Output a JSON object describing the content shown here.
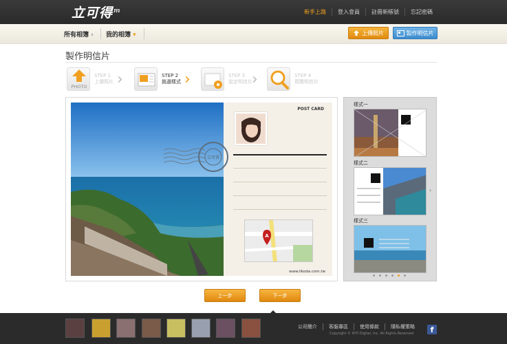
{
  "header": {
    "logo": "立可得",
    "logo_mark": "m",
    "links": [
      "新手上路",
      "登入會員",
      "註冊新帳號",
      "忘記密碼"
    ]
  },
  "subnav": {
    "tab_all": "所有相簿",
    "tab_mine": "我的相簿",
    "upload_label": "上傳照片",
    "make_label": "製作明信片"
  },
  "page_title": "製作明信片",
  "steps": [
    {
      "step": "STEP 1",
      "name": "上傳照片",
      "icon_text": "PHOTO"
    },
    {
      "step": "STEP 2",
      "name": "挑選樣式"
    },
    {
      "step": "STEP 3",
      "name": "設定明信片"
    },
    {
      "step": "STEP 4",
      "name": "預覽明信片"
    }
  ],
  "postcard": {
    "label": "POST CARD",
    "stamp_text": "POST CARD INPHOTO 立可得",
    "url": "www.likoda.com.tw"
  },
  "styles_panel": {
    "items": [
      "樣式一",
      "樣式二",
      "樣式三"
    ],
    "page_count": 6,
    "active_page": 5
  },
  "buttons": {
    "prev": "上一步",
    "next": "下一步"
  },
  "footer": {
    "links": [
      "公司簡介",
      "客服專區",
      "使用條款",
      "隱私權策略"
    ],
    "copyright": "Copyright © HiTi Digital, Inc. All Rights Reserved",
    "fb": "f"
  }
}
